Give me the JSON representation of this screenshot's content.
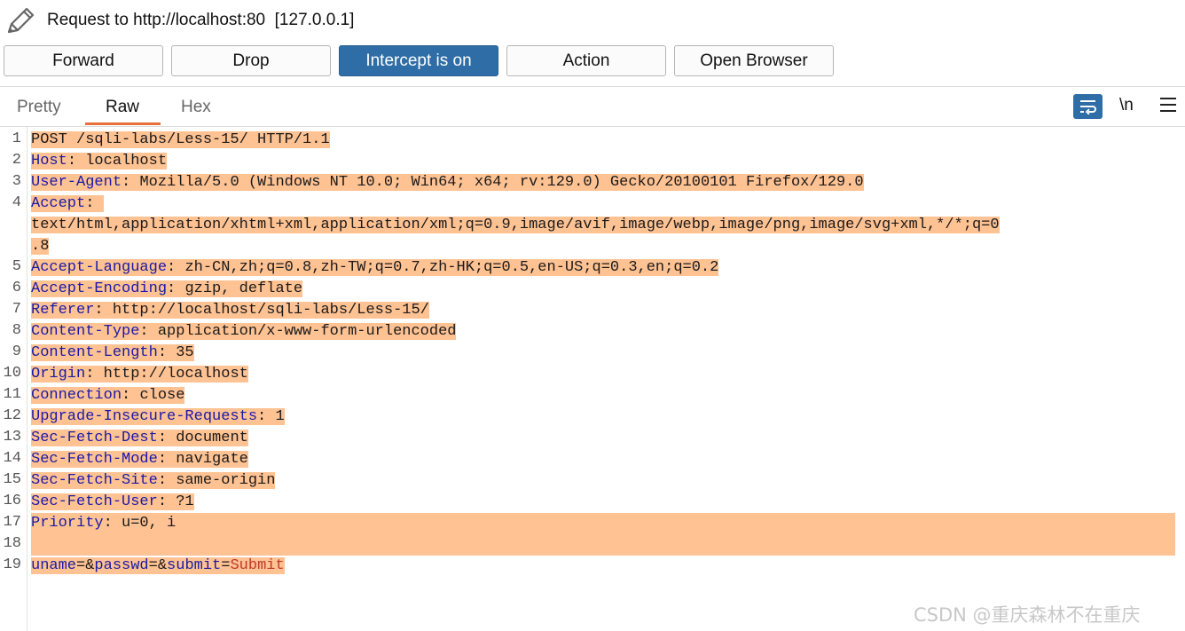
{
  "title": "Request to http://localhost:80  [127.0.0.1]",
  "toolbar": {
    "forward": "Forward",
    "drop": "Drop",
    "intercept": "Intercept is on",
    "action": "Action",
    "open_browser": "Open Browser"
  },
  "tabs": {
    "pretty": "Pretty",
    "raw": "Raw",
    "hex": "Hex",
    "active": "Raw"
  },
  "icons": {
    "title": "pencil-icon",
    "wrap": "word-wrap-icon",
    "newline": "\\n",
    "menu": "hamburger-menu-icon"
  },
  "colors": {
    "accent": "#2f6da6",
    "highlight": "#ffc293",
    "tab_underline": "#e8703a",
    "header_name": "#1a1aa6",
    "param_value": "#c0392b"
  },
  "request": {
    "line1": "POST /sqli-labs/Less-15/ HTTP/1.1",
    "headers": [
      {
        "num": "2",
        "name": "Host",
        "value": "localhost"
      },
      {
        "num": "3",
        "name": "User-Agent",
        "value": "Mozilla/5.0 (Windows NT 10.0; Win64; x64; rv:129.0) Gecko/20100101 Firefox/129.0"
      },
      {
        "num": "4",
        "name": "Accept",
        "value": ""
      },
      {
        "num": "5",
        "name": "Accept-Language",
        "value": "zh-CN,zh;q=0.8,zh-TW;q=0.7,zh-HK;q=0.5,en-US;q=0.3,en;q=0.2"
      },
      {
        "num": "6",
        "name": "Accept-Encoding",
        "value": "gzip, deflate"
      },
      {
        "num": "7",
        "name": "Referer",
        "value": "http://localhost/sqli-labs/Less-15/"
      },
      {
        "num": "8",
        "name": "Content-Type",
        "value": "application/x-www-form-urlencoded"
      },
      {
        "num": "9",
        "name": "Content-Length",
        "value": "35"
      },
      {
        "num": "10",
        "name": "Origin",
        "value": "http://localhost"
      },
      {
        "num": "11",
        "name": "Connection",
        "value": "close"
      },
      {
        "num": "12",
        "name": "Upgrade-Insecure-Requests",
        "value": "1"
      },
      {
        "num": "13",
        "name": "Sec-Fetch-Dest",
        "value": "document"
      },
      {
        "num": "14",
        "name": "Sec-Fetch-Mode",
        "value": "navigate"
      },
      {
        "num": "15",
        "name": "Sec-Fetch-Site",
        "value": "same-origin"
      },
      {
        "num": "16",
        "name": "Sec-Fetch-User",
        "value": "?1"
      },
      {
        "num": "17",
        "name": "Priority",
        "value": "u=0, i"
      }
    ],
    "accept_cont1": "text/html,application/xhtml+xml,application/xml;q=0.9,image/avif,image/webp,image/png,image/svg+xml,*/*;q=0",
    "accept_cont2": ".8",
    "body_line_num": "19",
    "empty_line_num": "18",
    "first_line_num": "1",
    "body": {
      "p1_name": "uname",
      "p1_value": "",
      "p2_name": "passwd",
      "p2_value": "",
      "p3_name": "submit",
      "p3_value": "Submit"
    }
  },
  "watermark": "CSDN @重庆森林不在重庆"
}
